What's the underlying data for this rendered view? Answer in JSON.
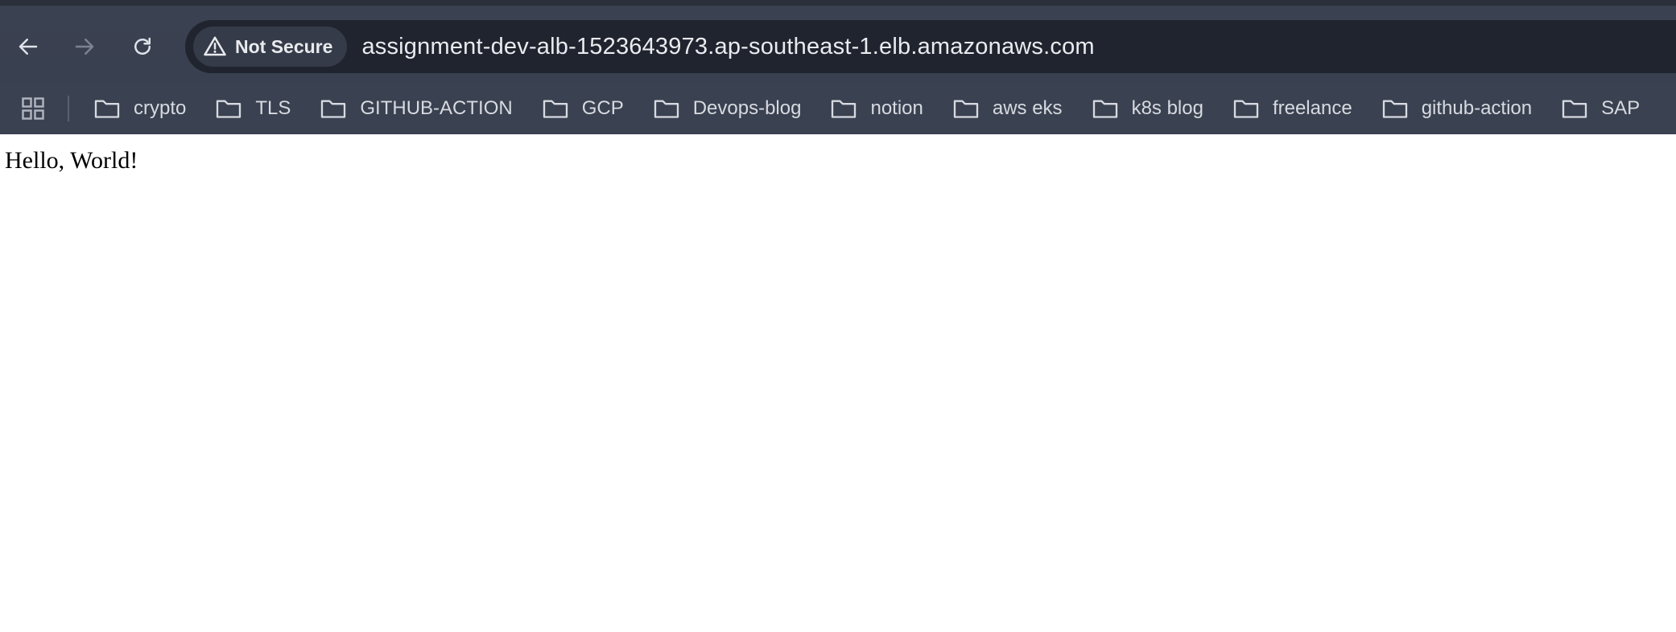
{
  "toolbar": {
    "back_icon": "back-arrow-icon",
    "forward_icon": "forward-arrow-icon",
    "reload_icon": "reload-icon"
  },
  "omnibox": {
    "security_label": "Not Secure",
    "security_icon": "warning-triangle-icon",
    "url": "assignment-dev-alb-1523643973.ap-southeast-1.elb.amazonaws.com"
  },
  "bookmarks": {
    "apps_icon": "apps-grid-icon",
    "items": [
      {
        "label": "crypto"
      },
      {
        "label": "TLS"
      },
      {
        "label": "GITHUB-ACTION"
      },
      {
        "label": "GCP"
      },
      {
        "label": "Devops-blog"
      },
      {
        "label": "notion"
      },
      {
        "label": "aws eks"
      },
      {
        "label": "k8s blog"
      },
      {
        "label": "freelance"
      },
      {
        "label": "github-action"
      },
      {
        "label": "SAP"
      }
    ]
  },
  "page": {
    "body_text": "Hello, World!"
  },
  "colors": {
    "toolbar_bg": "#3a4150",
    "omnibox_bg": "#20242e",
    "page_bg": "#ffffff"
  }
}
